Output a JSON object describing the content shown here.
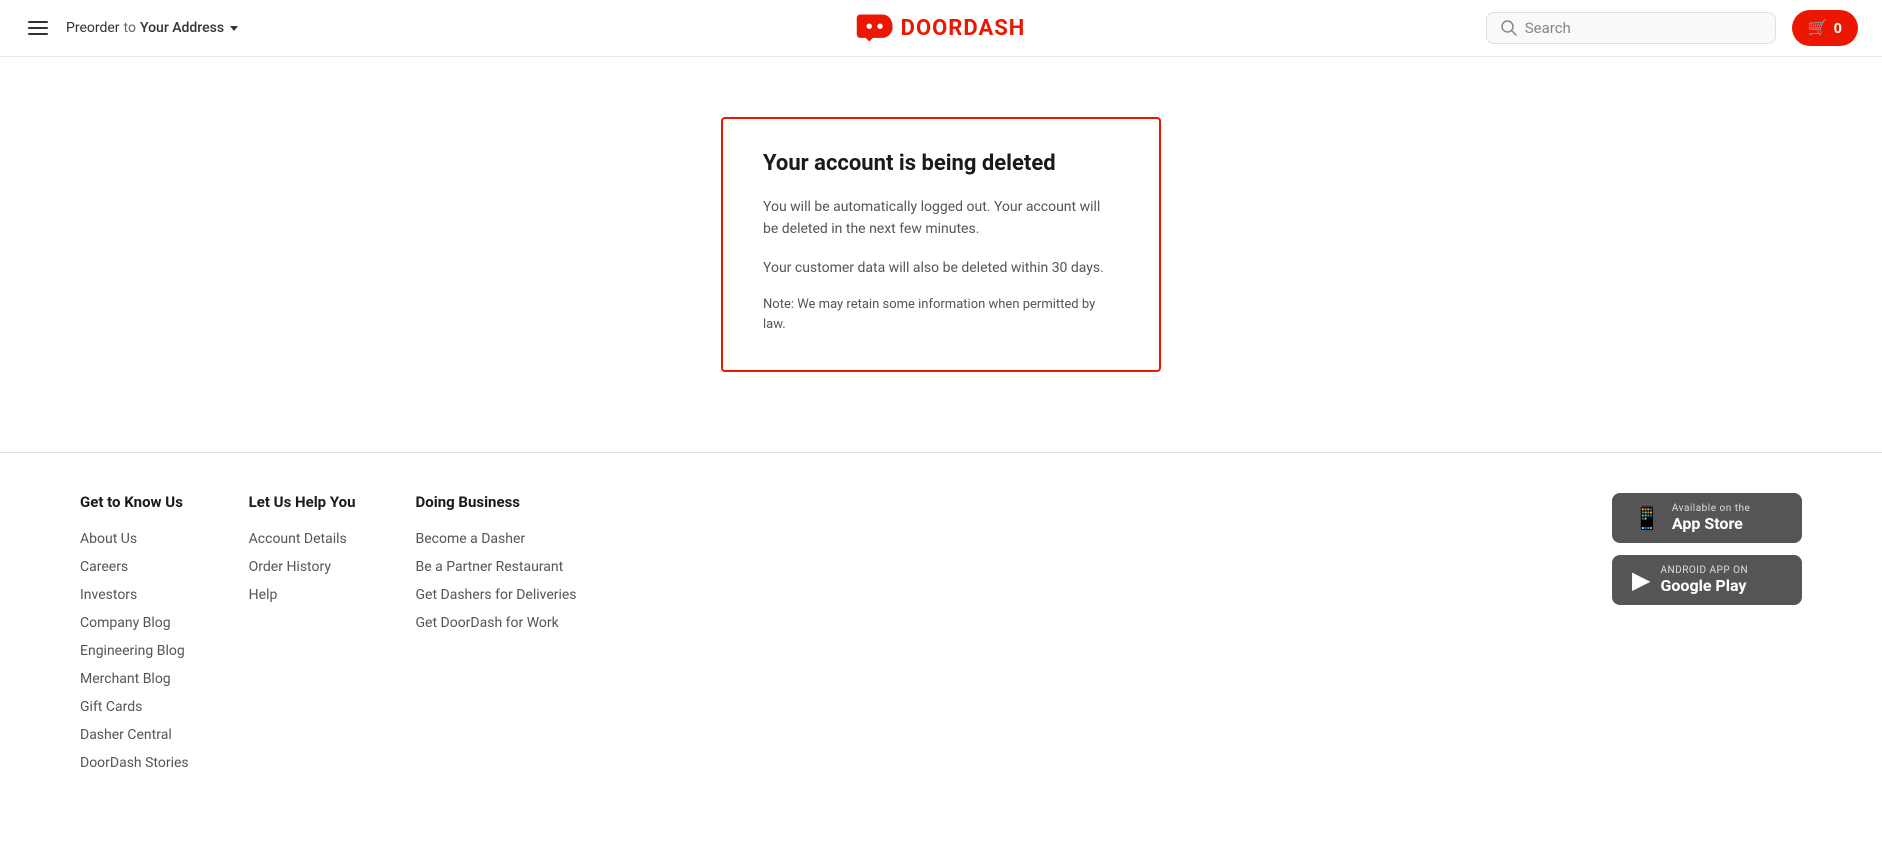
{
  "header": {
    "preorder_label": "Preorder",
    "to_label": "to",
    "address_label": "Your Address",
    "logo_text": "DOORDASH",
    "search_placeholder": "Search",
    "cart_count": "0"
  },
  "deletion_card": {
    "title": "Your account is being deleted",
    "body1": "You will be automatically logged out. Your account will be deleted in the next few minutes.",
    "body2": "Your customer data will also be deleted within 30 days.",
    "note": "Note: We may retain some information when permitted by law."
  },
  "footer": {
    "col1": {
      "title": "Get to Know Us",
      "links": [
        "About Us",
        "Careers",
        "Investors",
        "Company Blog",
        "Engineering Blog",
        "Merchant Blog",
        "Gift Cards",
        "Dasher Central",
        "DoorDash Stories"
      ]
    },
    "col2": {
      "title": "Let Us Help You",
      "links": [
        "Account Details",
        "Order History",
        "Help"
      ]
    },
    "col3": {
      "title": "Doing Business",
      "links": [
        "Become a Dasher",
        "Be a Partner Restaurant",
        "Get Dashers for Deliveries",
        "Get DoorDash for Work"
      ]
    },
    "app_store": {
      "sub": "Available on the",
      "main": "App Store"
    },
    "google_play": {
      "sub": "ANDROID APP ON",
      "main": "Google Play"
    }
  }
}
